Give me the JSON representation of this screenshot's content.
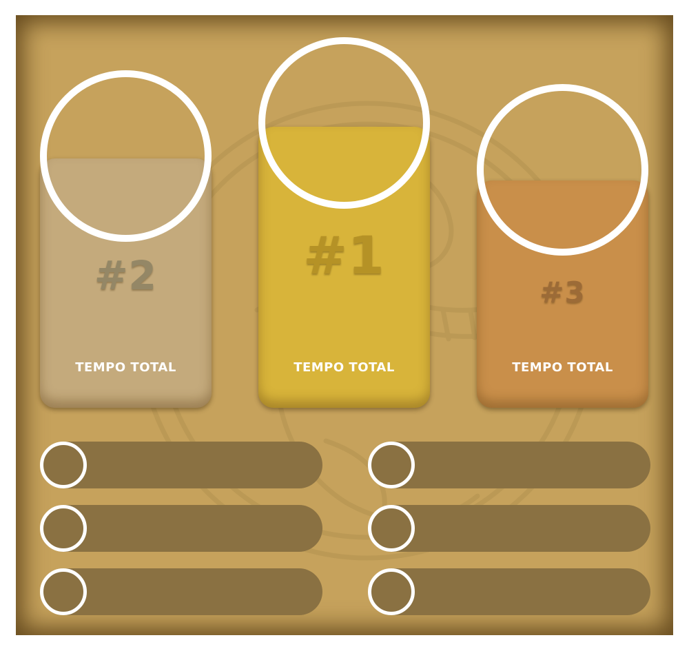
{
  "colors": {
    "board": "#c6a25c",
    "gold": "#d8b43a",
    "silver": "#c4aa7c",
    "bronze": "#c98f4a",
    "row": "#8a7142",
    "ring": "#ffffff"
  },
  "podium": [
    {
      "position": "second",
      "rank": "#2",
      "label": "TEMPO TOTAL",
      "color": "#c4aa7c",
      "rank_color": "#948766"
    },
    {
      "position": "first",
      "rank": "#1",
      "label": "TEMPO TOTAL",
      "color": "#d8b43a",
      "rank_color": "#b59226"
    },
    {
      "position": "third",
      "rank": "#3",
      "label": "TEMPO TOTAL",
      "color": "#c98f4a",
      "rank_color": "#9c6b37"
    }
  ],
  "ranking_rows": [
    "",
    "",
    "",
    "",
    "",
    ""
  ],
  "icons": {
    "avatar": "avatar-ring",
    "emblem": "snake-emblem-watermark"
  }
}
